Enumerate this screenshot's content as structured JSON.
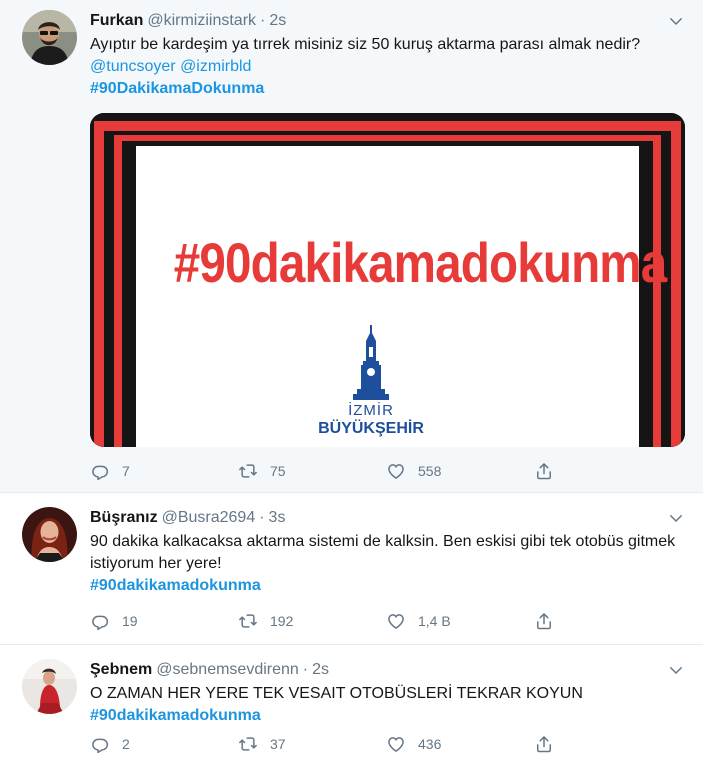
{
  "tweets": [
    {
      "name": "Furkan",
      "handle": "@kirmiziinstark",
      "time": "2s",
      "text": "Ayıptır be kardeşim ya tırrek misiniz siz 50 kuruş aktarma parası almak nedir?",
      "mentions": [
        "@tuncsoyer",
        "@izmirbld"
      ],
      "hashtag": "#90DakikamaDokunma",
      "media": {
        "headline": "#90dakikamadokunma",
        "logo_line1": "İZMİR",
        "logo_line2": "BÜYÜKŞEHİR"
      },
      "counts": {
        "replies": "7",
        "retweets": "75",
        "likes": "558"
      }
    },
    {
      "name": "Büşranız",
      "handle": "@Busra2694",
      "time": "3s",
      "text": "90 dakika kalkacaksa aktarma sistemi de kalksin. Ben eskisi gibi tek otobüs gitmek istiyorum her yere!",
      "hashtag": "#90dakikamadokunma",
      "counts": {
        "replies": "19",
        "retweets": "192",
        "likes": "1,4 B"
      }
    },
    {
      "name": "Şebnem",
      "handle": "@sebnemsevdirenn",
      "time": "2s",
      "text": "O ZAMAN HER YERE TEK VESAIT OTOBÜSLERİ TEKRAR KOYUN",
      "hashtag": "#90dakikamadokunma",
      "counts": {
        "replies": "2",
        "retweets": "37",
        "likes": "436"
      }
    }
  ],
  "separator": "·",
  "colors": {
    "link": "#1b95e0",
    "muted": "#657786",
    "highlight_bg": "#f5f8fa",
    "poster_red": "#e63b38",
    "logo_blue": "#1d4f9c"
  },
  "icons": [
    "reply-icon",
    "retweet-icon",
    "like-icon",
    "share-icon",
    "chevron-down-icon"
  ]
}
